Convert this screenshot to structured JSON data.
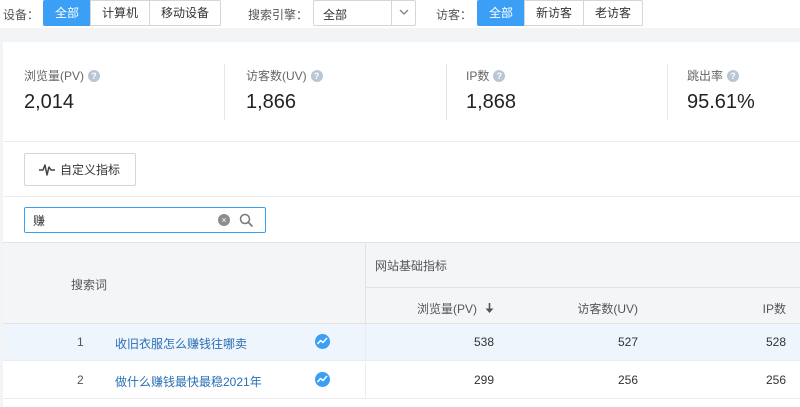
{
  "filters": {
    "device_label": "设备：",
    "device_options": [
      "全部",
      "计算机",
      "移动设备"
    ],
    "engine_label": "搜索引擎：",
    "engine_value": "全部",
    "visitor_label": "访客：",
    "visitor_options": [
      "全部",
      "新访客",
      "老访客"
    ]
  },
  "metrics": [
    {
      "label": "浏览量(PV)",
      "value": "2,014"
    },
    {
      "label": "访客数(UV)",
      "value": "1,866"
    },
    {
      "label": "IP数",
      "value": "1,868"
    },
    {
      "label": "跳出率",
      "value": "95.61%"
    }
  ],
  "help_icon_glyph": "?",
  "custom_button_label": "自定义指标",
  "search": {
    "value": "赚",
    "clear_glyph": "×"
  },
  "table": {
    "col_keyword": "搜索词",
    "group_header": "网站基础指标",
    "col_pv": "浏览量(PV)",
    "col_uv": "访客数(UV)",
    "col_ip": "IP数",
    "rows": [
      {
        "rank": "1",
        "keyword": "收旧衣服怎么赚钱往哪卖",
        "pv": "538",
        "uv": "527",
        "ip": "528"
      },
      {
        "rank": "2",
        "keyword": "做什么赚钱最快最稳2021年",
        "pv": "299",
        "uv": "256",
        "ip": "256"
      }
    ]
  },
  "colors": {
    "accent": "#3a9ff5",
    "link": "#2a6fb5",
    "row_highlight": "#eef5fc"
  },
  "icons": [
    "help-icon",
    "waveform-icon",
    "clear-icon",
    "search-icon",
    "chevron-down-icon",
    "sort-down-icon",
    "trend-icon"
  ]
}
